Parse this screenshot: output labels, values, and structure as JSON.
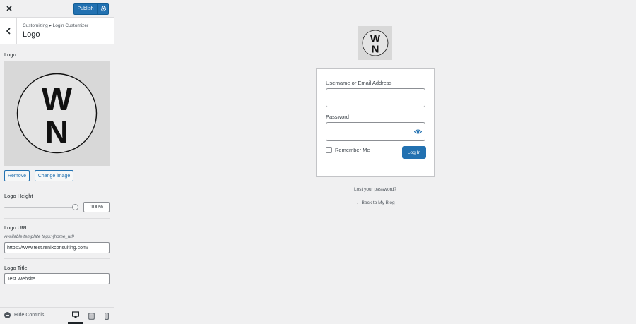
{
  "topbar": {
    "publish_label": "Publish"
  },
  "section": {
    "breadcrumb": "Customizing ▸ Login Customizer",
    "title": "Logo"
  },
  "logo_control": {
    "label": "Logo",
    "logo_text_top": "W",
    "logo_text_bottom": "N",
    "remove_label": "Remove",
    "change_label": "Change image"
  },
  "logo_height": {
    "label": "Logo Height",
    "value": "100%",
    "slider_fraction": 1.0
  },
  "logo_url": {
    "label": "Logo URL",
    "hint": "Available template tags: {home_url}",
    "value": "https://www.test.renixconsulting.com/"
  },
  "logo_title": {
    "label": "Logo Title",
    "value": "Test Website"
  },
  "footer": {
    "hide_controls_label": "Hide Controls"
  },
  "login": {
    "username_label": "Username or Email Address",
    "password_label": "Password",
    "remember_label": "Remember Me",
    "login_button": "Log In",
    "lost_password": "Lost your password?",
    "back_link": "← Back to My Blog"
  },
  "colors": {
    "accent": "#2271b1",
    "background": "#f0f0f1"
  }
}
